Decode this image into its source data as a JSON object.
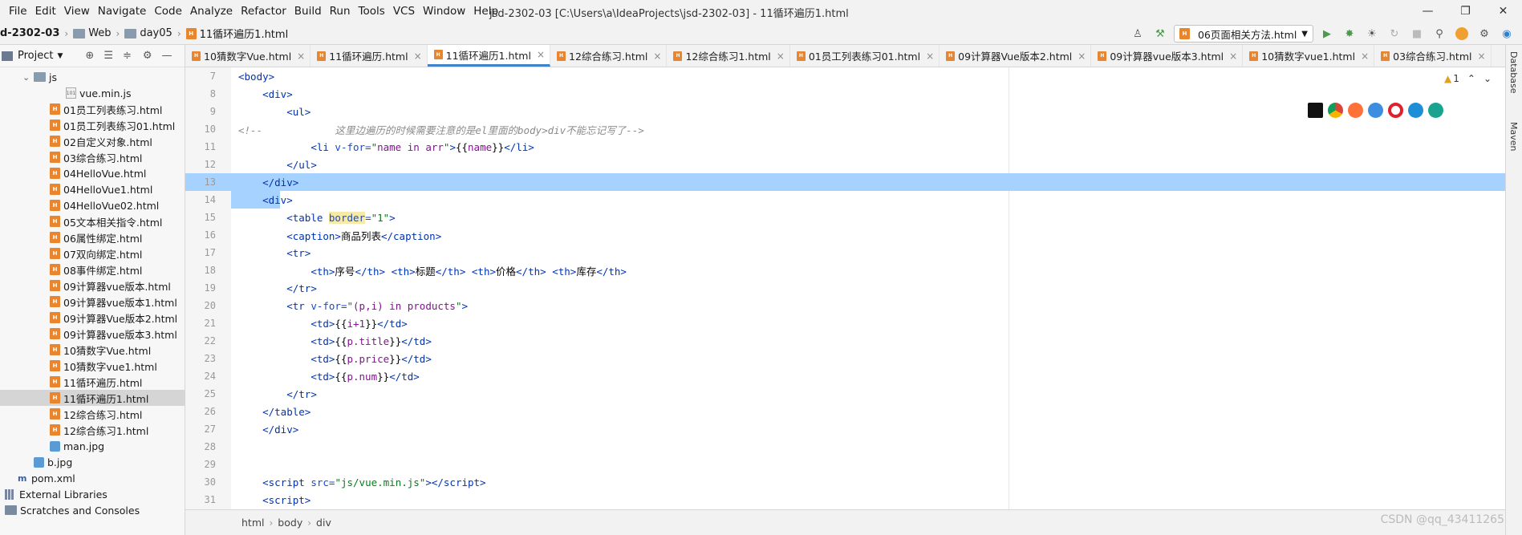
{
  "menu": [
    "File",
    "Edit",
    "View",
    "Navigate",
    "Code",
    "Analyze",
    "Refactor",
    "Build",
    "Run",
    "Tools",
    "VCS",
    "Window",
    "Help"
  ],
  "window_title": "jsd-2302-03 [C:\\Users\\a\\IdeaProjects\\jsd-2302-03] - 11循环遍历1.html",
  "window_controls": {
    "minimize": "—",
    "restore": "❐",
    "close": "✕"
  },
  "breadcrumb": [
    "d-2302-03",
    "Web",
    "day05",
    "11循环遍历1.html"
  ],
  "run_config": "06页面相关方法.html",
  "project_panel": {
    "title": "Project",
    "tools": [
      "⊕",
      "☰",
      "≑",
      "⚙",
      "—"
    ]
  },
  "tree": [
    {
      "label": "js",
      "kind": "folder",
      "indent": 1,
      "arrow": "⌄"
    },
    {
      "label": "vue.min.js",
      "kind": "js",
      "indent": 3
    },
    {
      "label": "01员工列表练习.html",
      "kind": "html",
      "indent": 2
    },
    {
      "label": "01员工列表练习01.html",
      "kind": "html",
      "indent": 2
    },
    {
      "label": "02自定义对象.html",
      "kind": "html",
      "indent": 2
    },
    {
      "label": "03综合练习.html",
      "kind": "html",
      "indent": 2
    },
    {
      "label": "04HelloVue.html",
      "kind": "html",
      "indent": 2
    },
    {
      "label": "04HelloVue1.html",
      "kind": "html",
      "indent": 2
    },
    {
      "label": "04HelloVue02.html",
      "kind": "html",
      "indent": 2
    },
    {
      "label": "05文本相关指令.html",
      "kind": "html",
      "indent": 2
    },
    {
      "label": "06属性绑定.html",
      "kind": "html",
      "indent": 2
    },
    {
      "label": "07双向绑定.html",
      "kind": "html",
      "indent": 2
    },
    {
      "label": "08事件绑定.html",
      "kind": "html",
      "indent": 2
    },
    {
      "label": "09计算器vue版本.html",
      "kind": "html",
      "indent": 2
    },
    {
      "label": "09计算器vue版本1.html",
      "kind": "html",
      "indent": 2
    },
    {
      "label": "09计算器Vue版本2.html",
      "kind": "html",
      "indent": 2
    },
    {
      "label": "09计算器vue版本3.html",
      "kind": "html",
      "indent": 2
    },
    {
      "label": "10猜数字Vue.html",
      "kind": "html",
      "indent": 2
    },
    {
      "label": "10猜数字vue1.html",
      "kind": "html",
      "indent": 2
    },
    {
      "label": "11循环遍历.html",
      "kind": "html",
      "indent": 2
    },
    {
      "label": "11循环遍历1.html",
      "kind": "html",
      "indent": 2,
      "selected": true
    },
    {
      "label": "12综合练习.html",
      "kind": "html",
      "indent": 2
    },
    {
      "label": "12综合练习1.html",
      "kind": "html",
      "indent": 2
    },
    {
      "label": "man.jpg",
      "kind": "img",
      "indent": 2
    },
    {
      "label": "b.jpg",
      "kind": "img",
      "indent": 1
    },
    {
      "label": "pom.xml",
      "kind": "pom",
      "indent": 0
    },
    {
      "label": "External Libraries",
      "kind": "lib",
      "indent": -1
    },
    {
      "label": "Scratches and Consoles",
      "kind": "scratch",
      "indent": -1
    }
  ],
  "tabs": [
    {
      "label": "10猜数字Vue.html"
    },
    {
      "label": "11循环遍历.html"
    },
    {
      "label": "11循环遍历1.html",
      "active": true
    },
    {
      "label": "12综合练习.html"
    },
    {
      "label": "12综合练习1.html"
    },
    {
      "label": "01员工列表练习01.html"
    },
    {
      "label": "09计算器Vue版本2.html"
    },
    {
      "label": "09计算器vue版本3.html"
    },
    {
      "label": "10猜数字vue1.html"
    },
    {
      "label": "03综合练习.html"
    }
  ],
  "code_lines": [
    {
      "n": 7,
      "html": "<span class=\"tg\">&lt;body&gt;</span>"
    },
    {
      "n": 8,
      "html": "    <span class=\"tg\">&lt;div&gt;</span>"
    },
    {
      "n": 9,
      "html": "        <span class=\"tg\">&lt;ul&gt;</span>"
    },
    {
      "n": 10,
      "html": "<span class=\"cm\">&lt;!--            这里边遍历的时候需要注意的是el里面的body&gt;div不能忘记写了--&gt;</span>"
    },
    {
      "n": 11,
      "html": "            <span class=\"tg\">&lt;li </span><span class=\"at\">v-for=</span><span class=\"st\">\"</span><span class=\"ex\">name in arr</span><span class=\"st\">\"</span><span class=\"tg\">&gt;</span>{{<span class=\"ex\">name</span>}}<span class=\"tg\">&lt;/li&gt;</span>"
    },
    {
      "n": 12,
      "html": "        <span class=\"tg\">&lt;/ul&gt;</span>"
    },
    {
      "n": 13,
      "html": "    <span class=\"tg\">&lt;/div&gt;</span>",
      "hl": true
    },
    {
      "n": 14,
      "html": "    <span class=\"tg\">&lt;div&gt;</span>",
      "hl_partial": true
    },
    {
      "n": 15,
      "html": "        <span class=\"tg\">&lt;table </span><span class=\"at\" style=\"background:#f5eaa7\">border</span><span class=\"at\">=</span><span class=\"st\">\"1\"</span><span class=\"tg\">&gt;</span>"
    },
    {
      "n": 16,
      "html": "        <span class=\"tg\">&lt;caption&gt;</span>商品列表<span class=\"tg\">&lt;/caption&gt;</span>"
    },
    {
      "n": 17,
      "html": "        <span class=\"tg\">&lt;tr&gt;</span>"
    },
    {
      "n": 18,
      "html": "            <span class=\"tg\">&lt;th&gt;</span>序号<span class=\"tg\">&lt;/th&gt;</span> <span class=\"tg\">&lt;th&gt;</span>标题<span class=\"tg\">&lt;/th&gt;</span> <span class=\"tg\">&lt;th&gt;</span>价格<span class=\"tg\">&lt;/th&gt;</span> <span class=\"tg\">&lt;th&gt;</span>库存<span class=\"tg\">&lt;/th&gt;</span>"
    },
    {
      "n": 19,
      "html": "        <span class=\"tg\">&lt;/tr&gt;</span>"
    },
    {
      "n": 20,
      "html": "        <span class=\"tg\">&lt;tr </span><span class=\"at\">v-for=</span><span class=\"st\">\"</span><span class=\"ex\">(p,i) in products</span><span class=\"st\">\"</span><span class=\"tg\">&gt;</span>"
    },
    {
      "n": 21,
      "html": "            <span class=\"tg\">&lt;td&gt;</span>{{<span class=\"ex\">i+1</span>}}<span class=\"tg\">&lt;/td&gt;</span>"
    },
    {
      "n": 22,
      "html": "            <span class=\"tg\">&lt;td&gt;</span>{{<span class=\"ex\">p.title</span>}}<span class=\"tg\">&lt;/td&gt;</span>"
    },
    {
      "n": 23,
      "html": "            <span class=\"tg\">&lt;td&gt;</span>{{<span class=\"ex\">p.price</span>}}<span class=\"tg\">&lt;/td&gt;</span>"
    },
    {
      "n": 24,
      "html": "            <span class=\"tg\">&lt;td&gt;</span>{{<span class=\"ex\">p.num</span>}}<span class=\"tg\">&lt;/td&gt;</span>"
    },
    {
      "n": 25,
      "html": "        <span class=\"tg\">&lt;/tr&gt;</span>"
    },
    {
      "n": 26,
      "html": "    <span class=\"tg\">&lt;/table&gt;</span>"
    },
    {
      "n": 27,
      "html": "    <span class=\"tg\">&lt;/div&gt;</span>"
    },
    {
      "n": 28,
      "html": ""
    },
    {
      "n": 29,
      "html": ""
    },
    {
      "n": 30,
      "html": "    <span class=\"tg\">&lt;script </span><span class=\"at\">src=</span><span class=\"st\">\"js/vue.min.js\"</span><span class=\"tg\">&gt;&lt;/script&gt;</span>"
    },
    {
      "n": 31,
      "html": "    <span class=\"tg\">&lt;script&gt;</span>"
    }
  ],
  "status_crumbs": [
    "html",
    "body",
    "div"
  ],
  "warning_count": "1",
  "right_tools": [
    "Database",
    "Maven"
  ],
  "watermark": "CSDN @qq_43411265",
  "colors": {
    "accent": "#4083c9",
    "selection": "#a6d2ff",
    "html_icon": "#e8862f"
  }
}
